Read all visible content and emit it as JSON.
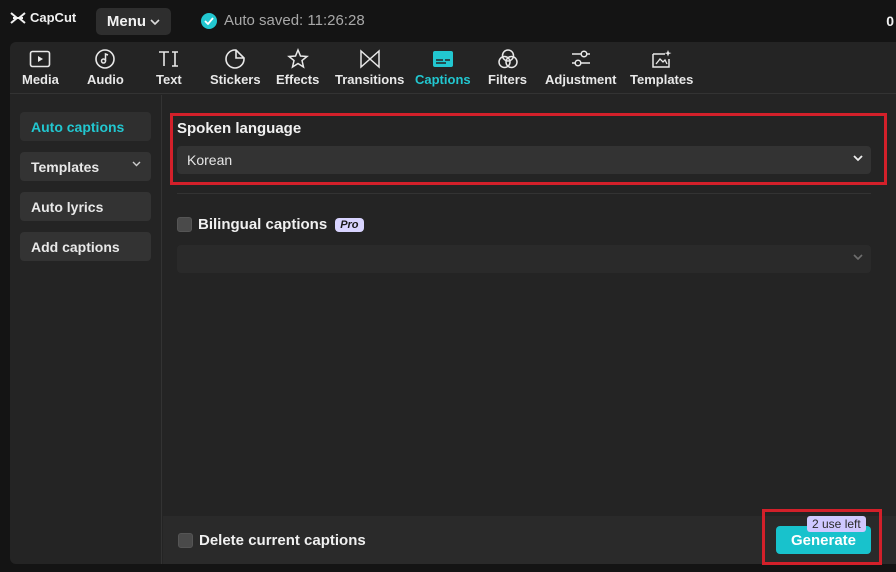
{
  "app": {
    "name": "CapCut",
    "menu_label": "Menu",
    "autosave": "Auto saved: 11:26:28",
    "corner_text": "0"
  },
  "toolbar": {
    "active": "Captions",
    "tools": [
      {
        "label": "Media",
        "icon": "media-icon"
      },
      {
        "label": "Audio",
        "icon": "audio-icon"
      },
      {
        "label": "Text",
        "icon": "text-icon"
      },
      {
        "label": "Stickers",
        "icon": "stickers-icon"
      },
      {
        "label": "Effects",
        "icon": "effects-icon"
      },
      {
        "label": "Transitions",
        "icon": "transitions-icon"
      },
      {
        "label": "Captions",
        "icon": "captions-icon"
      },
      {
        "label": "Filters",
        "icon": "filters-icon"
      },
      {
        "label": "Adjustment",
        "icon": "adjustment-icon"
      },
      {
        "label": "Templates",
        "icon": "templates-icon"
      }
    ]
  },
  "sidebar": {
    "items": [
      {
        "label": "Auto captions",
        "active": true
      },
      {
        "label": "Templates",
        "has_dropdown": true
      },
      {
        "label": "Auto lyrics"
      },
      {
        "label": "Add captions"
      }
    ]
  },
  "captions": {
    "spoken_language_label": "Spoken language",
    "spoken_language_value": "Korean",
    "bilingual_label": "Bilingual captions",
    "bilingual_badge": "Pro",
    "bilingual_checked": false,
    "bilingual_value": ""
  },
  "footer": {
    "delete_label": "Delete current captions",
    "delete_checked": false,
    "uses_left": "2 use left",
    "generate_label": "Generate"
  },
  "colors": {
    "accent": "#22c7d0",
    "highlight": "#d3202a",
    "panel": "#242424",
    "background": "#141414"
  }
}
